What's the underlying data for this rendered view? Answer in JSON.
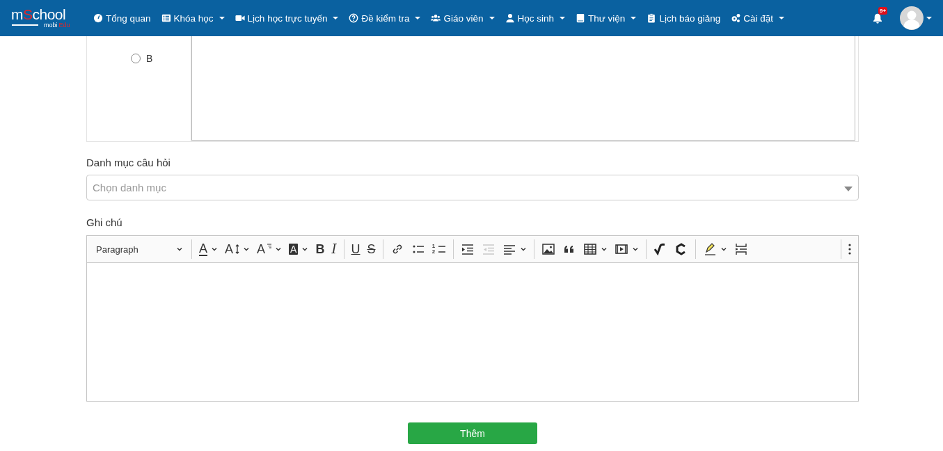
{
  "logo": {
    "parts": [
      {
        "text": "m",
        "accent": false
      },
      {
        "text": "S",
        "accent": true
      },
      {
        "text": "chool",
        "accent": false
      }
    ],
    "sub": [
      {
        "text": "mobi",
        "accent": false
      },
      {
        "text": "Edu",
        "accent": true
      }
    ]
  },
  "nav": [
    {
      "label": "Tổng quan",
      "kind": "gauge",
      "dropdown": false
    },
    {
      "label": "Khóa học",
      "kind": "list",
      "dropdown": true
    },
    {
      "label": "Lịch học trực tuyến",
      "kind": "video",
      "dropdown": true
    },
    {
      "label": "Đề kiểm tra",
      "kind": "question",
      "dropdown": true
    },
    {
      "label": "Giáo viên",
      "kind": "users",
      "dropdown": true
    },
    {
      "label": "Học sinh",
      "kind": "user",
      "dropdown": true
    },
    {
      "label": "Thư viện",
      "kind": "book",
      "dropdown": true
    },
    {
      "label": "Lịch báo giảng",
      "kind": "clipboard",
      "dropdown": false
    },
    {
      "label": "Cài đặt",
      "kind": "gears",
      "dropdown": true
    }
  ],
  "notifications": {
    "badge": "9+"
  },
  "answer": {
    "label": "B",
    "selected": false
  },
  "category": {
    "label": "Danh mục câu hỏi",
    "placeholder": "Chọn danh mục"
  },
  "note": {
    "label": "Ghi chú",
    "heading_select": "Paragraph",
    "tools": [
      {
        "kind": "sep"
      },
      {
        "kind": "font-color",
        "glyph": "A",
        "dropdown": true,
        "disabled": false
      },
      {
        "kind": "font-size",
        "glyph": "A",
        "dropdown": true,
        "disabled": false
      },
      {
        "kind": "font-family",
        "glyph": "A",
        "dropdown": true,
        "disabled": false
      },
      {
        "kind": "bg-color",
        "glyph": "A",
        "dropdown": true,
        "disabled": false
      },
      {
        "kind": "bold",
        "glyph": "B",
        "dropdown": false,
        "disabled": false
      },
      {
        "kind": "italic",
        "glyph": "I",
        "dropdown": false,
        "disabled": false
      },
      {
        "kind": "sep"
      },
      {
        "kind": "underline",
        "glyph": "U",
        "dropdown": false,
        "disabled": false
      },
      {
        "kind": "strike",
        "glyph": "S",
        "dropdown": false,
        "disabled": false
      },
      {
        "kind": "sep"
      },
      {
        "kind": "link",
        "dropdown": false,
        "disabled": false
      },
      {
        "kind": "bullets",
        "dropdown": false,
        "disabled": false
      },
      {
        "kind": "numbers",
        "glyph": "12",
        "dropdown": false,
        "disabled": false
      },
      {
        "kind": "sep"
      },
      {
        "kind": "indent",
        "dropdown": false,
        "disabled": false
      },
      {
        "kind": "outdent",
        "dropdown": false,
        "disabled": true
      },
      {
        "kind": "align",
        "dropdown": true,
        "disabled": false
      },
      {
        "kind": "sep"
      },
      {
        "kind": "image",
        "dropdown": false,
        "disabled": false
      },
      {
        "kind": "quote",
        "dropdown": false,
        "disabled": false
      },
      {
        "kind": "table",
        "dropdown": true,
        "disabled": false
      },
      {
        "kind": "media",
        "dropdown": true,
        "disabled": false
      },
      {
        "kind": "sep"
      },
      {
        "kind": "math",
        "dropdown": false,
        "disabled": false
      },
      {
        "kind": "chem",
        "dropdown": false,
        "disabled": false
      },
      {
        "kind": "sep"
      },
      {
        "kind": "highlight",
        "dropdown": true,
        "disabled": false
      },
      {
        "kind": "page-break",
        "dropdown": false,
        "disabled": false
      },
      {
        "kind": "spacer"
      },
      {
        "kind": "sep"
      },
      {
        "kind": "more",
        "dropdown": false,
        "disabled": false
      }
    ]
  },
  "submit": "Thêm"
}
